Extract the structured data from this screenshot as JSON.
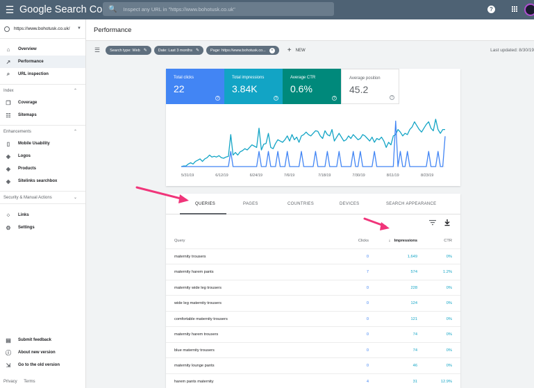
{
  "app": {
    "logo": "Google Search Console"
  },
  "search": {
    "placeholder": "Inspect any URL in \"https://www.bohotusk.co.uk\""
  },
  "sidebar": {
    "property": "https://www.bohotusk.co.uk/",
    "items_top": [
      {
        "label": "Overview",
        "icon": "home-icon"
      },
      {
        "label": "Performance",
        "icon": "trending-icon"
      },
      {
        "label": "URL inspection",
        "icon": "search-icon"
      }
    ],
    "section_index": "Index",
    "items_index": [
      {
        "label": "Coverage",
        "icon": "coverage-icon"
      },
      {
        "label": "Sitemaps",
        "icon": "sitemap-icon"
      }
    ],
    "section_enhancements": "Enhancements",
    "items_enh": [
      {
        "label": "Mobile Usability",
        "icon": "phone-icon"
      },
      {
        "label": "Logos",
        "icon": "diamond-icon"
      },
      {
        "label": "Products",
        "icon": "diamond-icon"
      },
      {
        "label": "Sitelinks searchbox",
        "icon": "diamond-icon"
      }
    ],
    "section_security": "Security & Manual Actions",
    "items_bottom": [
      {
        "label": "Links",
        "icon": "links-icon"
      },
      {
        "label": "Settings",
        "icon": "gear-icon"
      }
    ],
    "footer": [
      {
        "label": "Submit feedback",
        "icon": "feedback-icon"
      },
      {
        "label": "About new version",
        "icon": "info-icon"
      },
      {
        "label": "Go to the old version",
        "icon": "exit-icon"
      }
    ],
    "privacy": "Privacy",
    "terms": "Terms"
  },
  "header": {
    "title": "Performance"
  },
  "filters": {
    "chips": [
      "Search type: Web",
      "Date: Last 3 months",
      "Page: https://www.bohotusk.co..."
    ],
    "new_label": "NEW",
    "last_updated": "Last updated: 8/30/19"
  },
  "metrics": [
    {
      "label": "Total clicks",
      "value": "22",
      "color": "#4285f4"
    },
    {
      "label": "Total impressions",
      "value": "3.84K",
      "color": "#12a4c5"
    },
    {
      "label": "Average CTR",
      "value": "0.6%",
      "color": "#00897b"
    },
    {
      "label": "Average position",
      "value": "45.2",
      "color": "#ffffff"
    }
  ],
  "chart_data": {
    "type": "line",
    "x_tick_labels": [
      "5/31/19",
      "6/12/19",
      "6/24/19",
      "7/6/19",
      "7/18/19",
      "7/30/19",
      "8/11/19",
      "8/23/19"
    ],
    "series": [
      {
        "name": "Total impressions",
        "color": "#12a4c5",
        "values": [
          0,
          1,
          1,
          4,
          6,
          4,
          8,
          10,
          12,
          8,
          12,
          14,
          18,
          15,
          16,
          15,
          17,
          14,
          13,
          15,
          16,
          50,
          18,
          22,
          18,
          23,
          25,
          28,
          26,
          30,
          34,
          32,
          30,
          60,
          26,
          35,
          36,
          52,
          30,
          28,
          36,
          42,
          40,
          38,
          42,
          48,
          40,
          50,
          42,
          46,
          38,
          48,
          50,
          54,
          50,
          48,
          52,
          56,
          55,
          48,
          44,
          56,
          50,
          48,
          58,
          40,
          46,
          52,
          46,
          40,
          42,
          48,
          44,
          50,
          46,
          42,
          44,
          50,
          48,
          44,
          40,
          46,
          38,
          44,
          42,
          46,
          40,
          30,
          38,
          34,
          48,
          50,
          58,
          54,
          48,
          52,
          50,
          58,
          62,
          70,
          64,
          58,
          54,
          60,
          66,
          70,
          60,
          56,
          74,
          58,
          52,
          58,
          58
        ]
      },
      {
        "name": "Total clicks",
        "color": "#4285f4",
        "values": [
          0,
          0,
          0,
          0,
          0,
          0,
          0,
          0,
          0,
          0,
          0,
          0,
          0,
          0,
          0,
          0,
          0,
          0,
          0,
          0,
          0,
          1,
          0,
          0,
          0,
          0,
          0,
          0,
          0,
          0,
          0,
          0,
          0,
          1,
          0,
          0,
          0,
          1,
          0,
          0,
          0,
          1,
          0,
          0,
          0,
          1,
          0,
          0,
          0,
          0,
          0,
          1,
          0,
          0,
          0,
          0,
          0,
          1,
          0,
          0,
          0,
          0,
          1,
          0,
          0,
          0,
          0,
          1,
          0,
          0,
          0,
          0,
          0,
          1,
          0,
          0,
          1,
          0,
          0,
          0,
          0,
          0,
          1,
          0,
          0,
          0,
          0,
          0,
          0,
          0,
          0,
          3,
          0,
          1,
          0,
          0,
          1,
          0,
          0,
          0,
          0,
          0,
          0,
          0,
          0,
          1,
          0,
          0,
          0,
          1,
          0,
          0,
          2
        ]
      }
    ]
  },
  "tabs": [
    "QUERIES",
    "PAGES",
    "COUNTRIES",
    "DEVICES",
    "SEARCH APPEARANCE"
  ],
  "table": {
    "headers": [
      "Query",
      "Clicks",
      "Impressions",
      "CTR"
    ],
    "rows": [
      [
        "maternity trousers",
        "0",
        "1,649",
        "0%"
      ],
      [
        "maternity harem pants",
        "7",
        "574",
        "1.2%"
      ],
      [
        "maternity wide leg trousers",
        "0",
        "228",
        "0%"
      ],
      [
        "wide leg maternity trousers",
        "0",
        "124",
        "0%"
      ],
      [
        "comfortable maternity trousers",
        "0",
        "121",
        "0%"
      ],
      [
        "maternity harem trousers",
        "0",
        "74",
        "0%"
      ],
      [
        "blue maternity trousers",
        "0",
        "74",
        "0%"
      ],
      [
        "maternity lounge pants",
        "0",
        "46",
        "0%"
      ],
      [
        "harem pants maternity",
        "4",
        "31",
        "12.9%"
      ]
    ]
  },
  "annotation_color": "#f0357a"
}
